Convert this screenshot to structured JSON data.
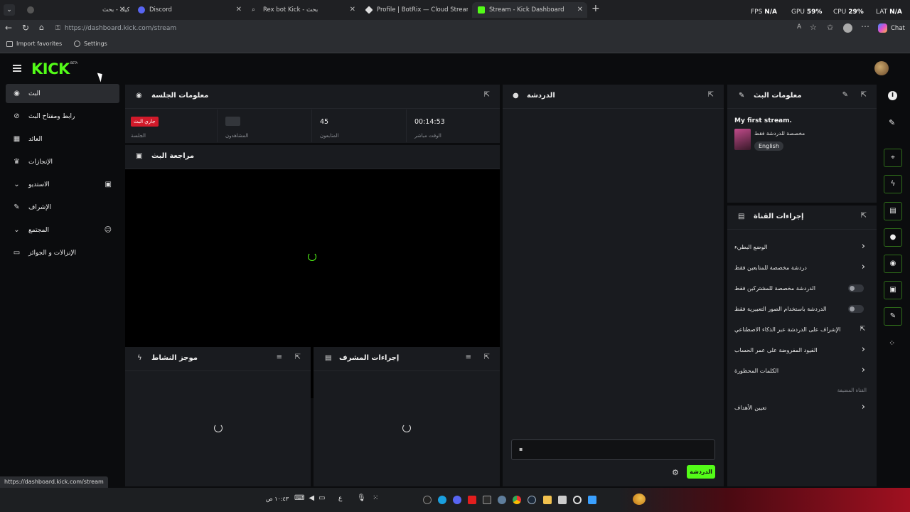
{
  "browser": {
    "tabs": [
      {
        "label": "كيك - بحث",
        "active": false
      },
      {
        "label": "Discord",
        "active": false
      },
      {
        "label": "Rex bot Kick - بحث",
        "active": false
      },
      {
        "label": "Profile | BotRix — Cloud Streaming",
        "active": false
      },
      {
        "label": "Stream - Kick Dashboard",
        "active": true
      }
    ],
    "new_tab": "+",
    "stats": {
      "fps_label": "FPS",
      "fps": "N/A",
      "gpu_label": "GPU",
      "gpu": "59%",
      "cpu_label": "CPU",
      "cpu": "29%",
      "lat_label": "LAT",
      "lat": "N/A"
    },
    "url": "https://dashboard.kick.com/stream",
    "chat_button": "Chat",
    "bookmarks": [
      {
        "label": "Import favorites"
      },
      {
        "label": "Settings"
      }
    ],
    "status_url": "https://dashboard.kick.com/stream"
  },
  "app": {
    "logo": "KICK",
    "beta": "BETA",
    "accent": "#53fc18"
  },
  "sidebar": {
    "items": [
      {
        "label": "البث",
        "icon": "broadcast-icon"
      },
      {
        "label": "رابط ومفتاح البث",
        "icon": "link-icon"
      },
      {
        "label": "العائد",
        "icon": "chart-icon"
      },
      {
        "label": "الإنجازات",
        "icon": "trophy-icon"
      },
      {
        "label": "الاستديو",
        "icon": "chevron-down-icon"
      },
      {
        "label": "الإشراف",
        "icon": "wrench-icon"
      },
      {
        "label": "المجتمع",
        "icon": "chevron-down-icon"
      },
      {
        "label": "الإنزالات و الجوائز",
        "icon": "gift-icon"
      }
    ]
  },
  "session": {
    "title": "معلومات الجلسة",
    "live_badge": "جاري البث",
    "cells": [
      {
        "value": "",
        "key": "الجلسة"
      },
      {
        "value": "",
        "key": "المشاهدون"
      },
      {
        "value": "45",
        "key": "المتابعون"
      },
      {
        "value": "00:14:53",
        "key": "الوقت مباشر"
      }
    ]
  },
  "preview": {
    "title": "مراجعة البث"
  },
  "activity": {
    "title": "موجز النشاط"
  },
  "modactions": {
    "title": "إجراءات المشرف"
  },
  "chat": {
    "title": "الدردشة",
    "send_button": "الدردشة",
    "input_placeholder": ""
  },
  "stream_info": {
    "title": "معلومات البث",
    "stream_title": "My first stream.",
    "category": "مخصصة للدردشة فقط",
    "language": "English"
  },
  "channel_actions": {
    "title": "إجراءات القناة",
    "rows": [
      {
        "label": "الوضع البطيء",
        "type": "chevron"
      },
      {
        "label": "دردشة مخصصة للمتابعين فقط",
        "type": "chevron"
      },
      {
        "label": "الدردشة مخصصة للمشتركين فقط",
        "type": "toggle"
      },
      {
        "label": "الدردشة باستخدام الصور التعبيرية فقط",
        "type": "toggle"
      },
      {
        "label": "الإشراف على الدردشة عبر الذكاء الاصطناعي",
        "type": "external"
      },
      {
        "label": "القيود المفروضة على عمر الحساب",
        "type": "chevron"
      },
      {
        "label": "الكلمات المحظورة",
        "type": "chevron"
      }
    ],
    "section_label": "القناة المضيفة",
    "goals_row": "تعيين الأهداف"
  },
  "taskbar": {
    "clock": "١٠:٤٣ ص",
    "lang": "ع"
  }
}
